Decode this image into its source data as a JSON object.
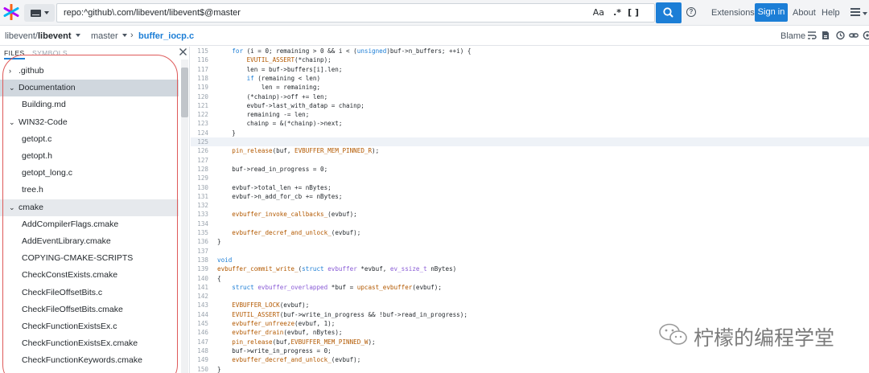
{
  "colors": {
    "accent": "#1c7ed6",
    "keyword": "#1c7ed6",
    "macro": "#b35900",
    "type": "#8a5cd6",
    "line_numbers": "#9aa3ad",
    "selected_row": "#d0d7de",
    "annotation": "#de5a5a"
  },
  "topbar": {
    "query": "repo:^github\\.com/libevent/libevent$@master",
    "opt_case": "Aa",
    "opt_regex": ".*",
    "opt_structural": "[ ]",
    "search_icon": "search-icon",
    "help_icon": "help-icon",
    "help_glyph": "?",
    "extensions": "Extensions",
    "sign_in": "Sign in",
    "about": "About",
    "help": "Help",
    "menu_icon": "hamburger-menu-icon"
  },
  "breadcrumb": {
    "repo_org": "libevent/",
    "repo_name": "libevent",
    "branch": "master",
    "separator": "›",
    "file": "buffer_iocp.c"
  },
  "file_actions": {
    "blame": "Blame",
    "icons": [
      "wrap-lines-icon",
      "raw-file-icon",
      "history-icon",
      "link-icon",
      "external-link-icon"
    ]
  },
  "sidebar": {
    "tab_files": "FILES",
    "tab_symbols": "SYMBOLS",
    "close_icon": "close-icon",
    "rows": [
      {
        "label": ".github",
        "chev": "›",
        "state": ""
      },
      {
        "label": "Documentation",
        "chev": "⌄",
        "state": "selected"
      },
      {
        "label": "Building.md",
        "chev": "",
        "state": ""
      },
      {
        "label": "WIN32-Code",
        "chev": "⌄",
        "state": ""
      },
      {
        "label": "getopt.c",
        "chev": "",
        "state": ""
      },
      {
        "label": "getopt.h",
        "chev": "",
        "state": ""
      },
      {
        "label": "getopt_long.c",
        "chev": "",
        "state": ""
      },
      {
        "label": "tree.h",
        "chev": "",
        "state": ""
      },
      {
        "label": "cmake",
        "chev": "⌄",
        "state": "hover"
      },
      {
        "label": "AddCompilerFlags.cmake",
        "chev": "",
        "state": ""
      },
      {
        "label": "AddEventLibrary.cmake",
        "chev": "",
        "state": ""
      },
      {
        "label": "COPYING-CMAKE-SCRIPTS",
        "chev": "",
        "state": ""
      },
      {
        "label": "CheckConstExists.cmake",
        "chev": "",
        "state": ""
      },
      {
        "label": "CheckFileOffsetBits.c",
        "chev": "",
        "state": ""
      },
      {
        "label": "CheckFileOffsetBits.cmake",
        "chev": "",
        "state": ""
      },
      {
        "label": "CheckFunctionExistsEx.c",
        "chev": "",
        "state": ""
      },
      {
        "label": "CheckFunctionExistsEx.cmake",
        "chev": "",
        "state": ""
      },
      {
        "label": "CheckFunctionKeywords.cmake",
        "chev": "",
        "state": ""
      }
    ]
  },
  "code": {
    "lines": [
      {
        "n": "115",
        "t": "    for (i = 0; remaining > 0 && i < (unsigned)buf->n_buffers; ++i) {"
      },
      {
        "n": "116",
        "t": "        EVUTIL_ASSERT(*chainp);"
      },
      {
        "n": "117",
        "t": "        len = buf->buffers[i].len;"
      },
      {
        "n": "118",
        "t": "        if (remaining < len)"
      },
      {
        "n": "119",
        "t": "            len = remaining;"
      },
      {
        "n": "120",
        "t": "        (*chainp)->off += len;"
      },
      {
        "n": "121",
        "t": "        evbuf->last_with_datap = chainp;"
      },
      {
        "n": "122",
        "t": "        remaining -= len;"
      },
      {
        "n": "123",
        "t": "        chainp = &(*chainp)->next;"
      },
      {
        "n": "124",
        "t": "    }"
      },
      {
        "n": "125",
        "t": "",
        "hl": true
      },
      {
        "n": "126",
        "t": "    pin_release(buf, EVBUFFER_MEM_PINNED_R);"
      },
      {
        "n": "127",
        "t": ""
      },
      {
        "n": "128",
        "t": "    buf->read_in_progress = 0;"
      },
      {
        "n": "129",
        "t": ""
      },
      {
        "n": "130",
        "t": "    evbuf->total_len += nBytes;"
      },
      {
        "n": "131",
        "t": "    evbuf->n_add_for_cb += nBytes;"
      },
      {
        "n": "132",
        "t": ""
      },
      {
        "n": "133",
        "t": "    evbuffer_invoke_callbacks_(evbuf);"
      },
      {
        "n": "134",
        "t": ""
      },
      {
        "n": "135",
        "t": "    evbuffer_decref_and_unlock_(evbuf);"
      },
      {
        "n": "136",
        "t": "}"
      },
      {
        "n": "137",
        "t": ""
      },
      {
        "n": "138",
        "t": "void"
      },
      {
        "n": "139",
        "t": "evbuffer_commit_write_(struct evbuffer *evbuf, ev_ssize_t nBytes)"
      },
      {
        "n": "140",
        "t": "{"
      },
      {
        "n": "141",
        "t": "    struct evbuffer_overlapped *buf = upcast_evbuffer(evbuf);"
      },
      {
        "n": "142",
        "t": ""
      },
      {
        "n": "143",
        "t": "    EVBUFFER_LOCK(evbuf);"
      },
      {
        "n": "144",
        "t": "    EVUTIL_ASSERT(buf->write_in_progress && !buf->read_in_progress);"
      },
      {
        "n": "145",
        "t": "    evbuffer_unfreeze(evbuf, 1);"
      },
      {
        "n": "146",
        "t": "    evbuffer_drain(evbuf, nBytes);"
      },
      {
        "n": "147",
        "t": "    pin_release(buf,EVBUFFER_MEM_PINNED_W);"
      },
      {
        "n": "148",
        "t": "    buf->write_in_progress = 0;"
      },
      {
        "n": "149",
        "t": "    evbuffer_decref_and_unlock_(evbuf);"
      },
      {
        "n": "150",
        "t": "}"
      }
    ]
  },
  "watermark": {
    "text": "柠檬的编程学堂",
    "icon": "wechat-logo-icon"
  }
}
